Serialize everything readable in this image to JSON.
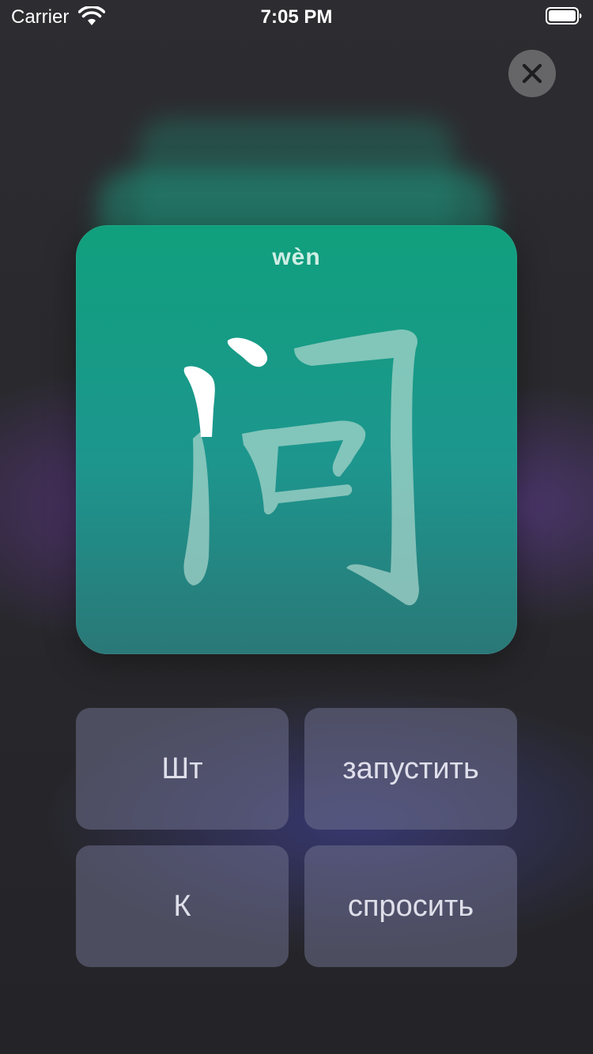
{
  "status_bar": {
    "carrier": "Carrier",
    "time": "7:05 PM",
    "wifi_icon": "wifi-icon",
    "battery_icon": "battery-icon"
  },
  "close": {
    "icon": "close-icon"
  },
  "card": {
    "pinyin": "wèn",
    "hanzi": "问",
    "color": "#10a07d"
  },
  "answers": [
    {
      "label": "Шт"
    },
    {
      "label": "запустить"
    },
    {
      "label": "К"
    },
    {
      "label": "спросить"
    }
  ]
}
